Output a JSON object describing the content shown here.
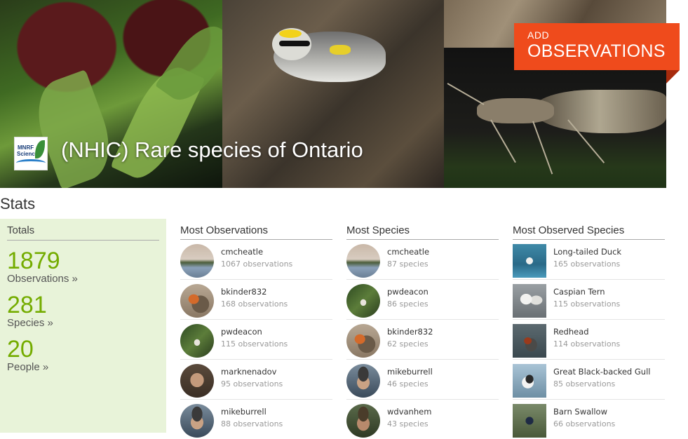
{
  "header": {
    "project_title": "(NHIC) Rare species of Ontario",
    "logo_text_line1": "MNRF",
    "logo_text_line2": "Science",
    "add_button_small": "ADD",
    "add_button_large": "OBSERVATIONS"
  },
  "stats": {
    "heading": "Stats",
    "totals": {
      "heading": "Totals",
      "items": [
        {
          "value": "1879",
          "label": "Observations »"
        },
        {
          "value": "281",
          "label": "Species »"
        },
        {
          "value": "20",
          "label": "People »"
        }
      ]
    },
    "most_observations": {
      "heading": "Most Observations",
      "rows": [
        {
          "name": "cmcheatle",
          "sub": "1067 observations",
          "avatar": "landscape"
        },
        {
          "name": "bkinder832",
          "sub": "168 observations",
          "avatar": "bird"
        },
        {
          "name": "pwdeacon",
          "sub": "115 observations",
          "avatar": "forest"
        },
        {
          "name": "marknenadov",
          "sub": "95 observations",
          "avatar": "face"
        },
        {
          "name": "mikeburrell",
          "sub": "88 observations",
          "avatar": "face-cap"
        }
      ]
    },
    "most_species": {
      "heading": "Most Species",
      "rows": [
        {
          "name": "cmcheatle",
          "sub": "87 species",
          "avatar": "landscape"
        },
        {
          "name": "pwdeacon",
          "sub": "86 species",
          "avatar": "forest"
        },
        {
          "name": "bkinder832",
          "sub": "62 species",
          "avatar": "bird"
        },
        {
          "name": "mikeburrell",
          "sub": "46 species",
          "avatar": "face-cap"
        },
        {
          "name": "wdvanhem",
          "sub": "43 species",
          "avatar": "face-cap2"
        }
      ]
    },
    "most_observed_species": {
      "heading": "Most Observed Species",
      "rows": [
        {
          "name": "Long-tailed Duck",
          "sub": "165 observations",
          "thumb": "duck"
        },
        {
          "name": "Caspian Tern",
          "sub": "115 observations",
          "thumb": "tern"
        },
        {
          "name": "Redhead",
          "sub": "114 observations",
          "thumb": "redhead"
        },
        {
          "name": "Great Black-backed Gull",
          "sub": "85 observations",
          "thumb": "gull"
        },
        {
          "name": "Barn Swallow",
          "sub": "66 observations",
          "thumb": "swallow"
        }
      ]
    }
  },
  "colors": {
    "accent_orange": "#ef4b1c",
    "stat_green": "#74ac00",
    "totals_bg": "#e8f3d9"
  }
}
